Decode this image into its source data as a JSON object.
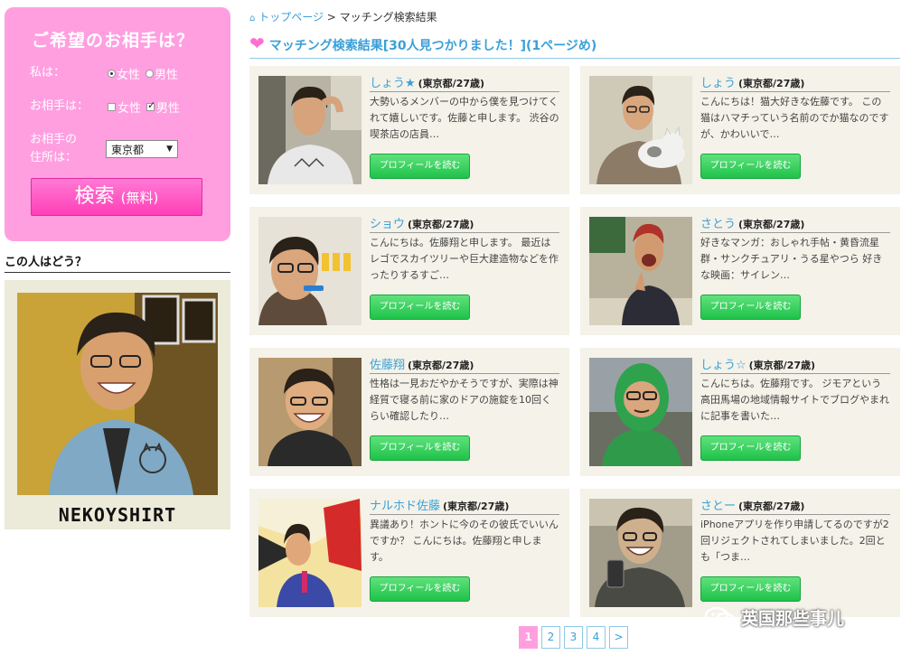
{
  "sidebar": {
    "title": "ご希望のお相手は？",
    "me_label": "私は：",
    "me_options": [
      "女性",
      "男性"
    ],
    "partner_label": "お相手は：",
    "partner_options": [
      "女性",
      "男性"
    ],
    "address_label_line1": "お相手の",
    "address_label_line2": "住所は：",
    "address_value": "東京都",
    "search_button": "検索",
    "search_button_sub": "(無料)",
    "featured_heading": "この人はどう？",
    "featured_caption": "NEKOYSHIRT"
  },
  "breadcrumb": {
    "home": "トップページ",
    "separator": ">",
    "current": "マッチング検索結果"
  },
  "results_title": "マッチング検索結果[30人見つかりました！](1ページめ)",
  "profiles": [
    {
      "name": "しょう★",
      "meta": "(東京都/27歳)",
      "intro": "大勢いるメンバーの中から僕を見つけてくれて嬉しいです。佐藤と申します。 渋谷の喫茶店の店員…",
      "button": "プロフィールを読む"
    },
    {
      "name": "しょう",
      "meta": "(東京都/27歳)",
      "intro": "こんにちは！猫大好きな佐藤です。 この猫はハマチっていう名前のでか猫なのですが、かわいいで…",
      "button": "プロフィールを読む"
    },
    {
      "name": "ショウ",
      "meta": "(東京都/27歳)",
      "intro": "こんにちは。佐藤翔と申します。 最近はレゴでスカイツリーや巨大建造物などを作ったりするすご…",
      "button": "プロフィールを読む"
    },
    {
      "name": "さとう",
      "meta": "(東京都/27歳)",
      "intro": "好きなマンガ：おしゃれ手帖・黄昏流星群・サンクチュアリ・うる星やつら 好きな映画：サイレン…",
      "button": "プロフィールを読む"
    },
    {
      "name": "佐藤翔",
      "meta": "(東京都/27歳)",
      "intro": "性格は一見おだやかそうですが、実際は神経質で寝る前に家のドアの施錠を10回くらい確認したり…",
      "button": "プロフィールを読む"
    },
    {
      "name": "しょう☆",
      "meta": "(東京都/27歳)",
      "intro": "こんにちは。佐藤翔です。 ジモアという高田馬場の地域情報サイトでブログやまれに記事を書いた…",
      "button": "プロフィールを読む"
    },
    {
      "name": "ナルホド佐藤",
      "meta": "(東京都/27歳)",
      "intro": "異議あり！ホントに今のその彼氏でいいんですか？ こんにちは。佐藤翔と申します。",
      "button": "プロフィールを読む"
    },
    {
      "name": "さとー",
      "meta": "(東京都/27歳)",
      "intro": "iPhoneアプリを作り申請してるのですが2回リジェクトされてしまいました。2回とも「つま…",
      "button": "プロフィールを読む"
    }
  ],
  "pagination": [
    "1",
    "2",
    "3",
    "4",
    ">"
  ],
  "watermark": "英国那些事儿",
  "colors": {
    "accent_pink": "#ff9fe0",
    "link_blue": "#3aa0d8",
    "button_green": "#2fcf57",
    "card_bg": "#f4f2e9"
  }
}
